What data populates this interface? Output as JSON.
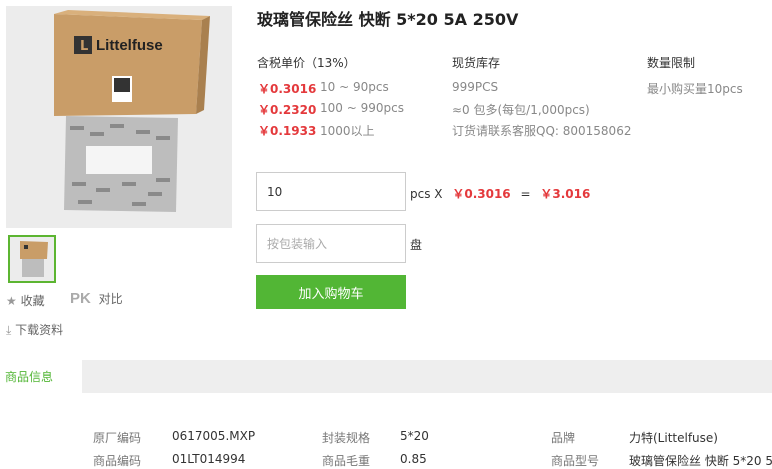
{
  "product": {
    "title": "玻璃管保险丝 快断 5*20 5A 250V",
    "brand_logo_text": "Littelfuse"
  },
  "aux_links": {
    "favorite": "收藏",
    "compare_badge": "PK",
    "compare": "对比",
    "download": "下载资料"
  },
  "pricing": {
    "header": "含税单价（13%）",
    "tiers": [
      {
        "price": "￥0.3016",
        "range": "10 ~ 90pcs"
      },
      {
        "price": "￥0.2320",
        "range": "100 ~ 990pcs"
      },
      {
        "price": "￥0.1933",
        "range": "1000以上"
      }
    ]
  },
  "stock": {
    "header": "现货库存",
    "qty": "999PCS",
    "packs": "≈0 包多(每包/1,000pcs)",
    "contact": "订货请联系客服QQ: 800158062"
  },
  "limit": {
    "header": "数量限制",
    "text": "最小购买量10pcs"
  },
  "order": {
    "qty_value": "10",
    "unit_x": "pcs X",
    "unit_price": "￥0.3016",
    "equals": "=",
    "total": "￥3.016",
    "pack_placeholder": "按包装输入",
    "pack_unit": "盘",
    "add_to_cart": "加入购物车"
  },
  "tabs": {
    "active": "商品信息"
  },
  "specs": [
    {
      "label": "原厂编码",
      "value": "0617005.MXP"
    },
    {
      "label": "封装规格",
      "value": "5*20"
    },
    {
      "label": "品牌",
      "value": "力特(Littelfuse)"
    },
    {
      "label": "商品编码",
      "value": "01LT014994"
    },
    {
      "label": "商品毛重",
      "value": "0.85"
    },
    {
      "label": "商品型号",
      "value": "玻璃管保险丝 快断 5*20 5..."
    }
  ],
  "colors": {
    "accent_green": "#52b635",
    "price_red": "#e4393c"
  }
}
